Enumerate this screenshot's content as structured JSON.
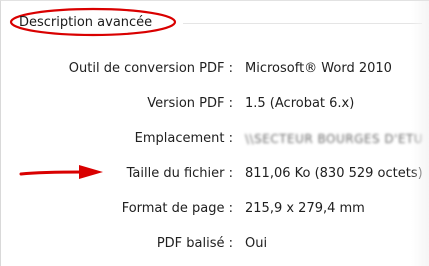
{
  "section": {
    "title": "Description avancée"
  },
  "properties": [
    {
      "label": "Outil de conversion PDF :",
      "value": "Microsoft® Word 2010"
    },
    {
      "label": "Version PDF :",
      "value": "1.5 (Acrobat 6.x)"
    },
    {
      "label": "Emplacement :",
      "value": "\\\\SECTEUR BOURGES D'ETU"
    },
    {
      "label": "Taille du fichier :",
      "value": "811,06 Ko (830 529 octets)"
    },
    {
      "label": "Format de page :",
      "value": "215,9 x 279,4 mm"
    },
    {
      "label": "PDF balisé :",
      "value": "Oui"
    }
  ],
  "annotations": {
    "highlight_color": "#d90000",
    "arrow_points_to": "Taille du fichier"
  }
}
